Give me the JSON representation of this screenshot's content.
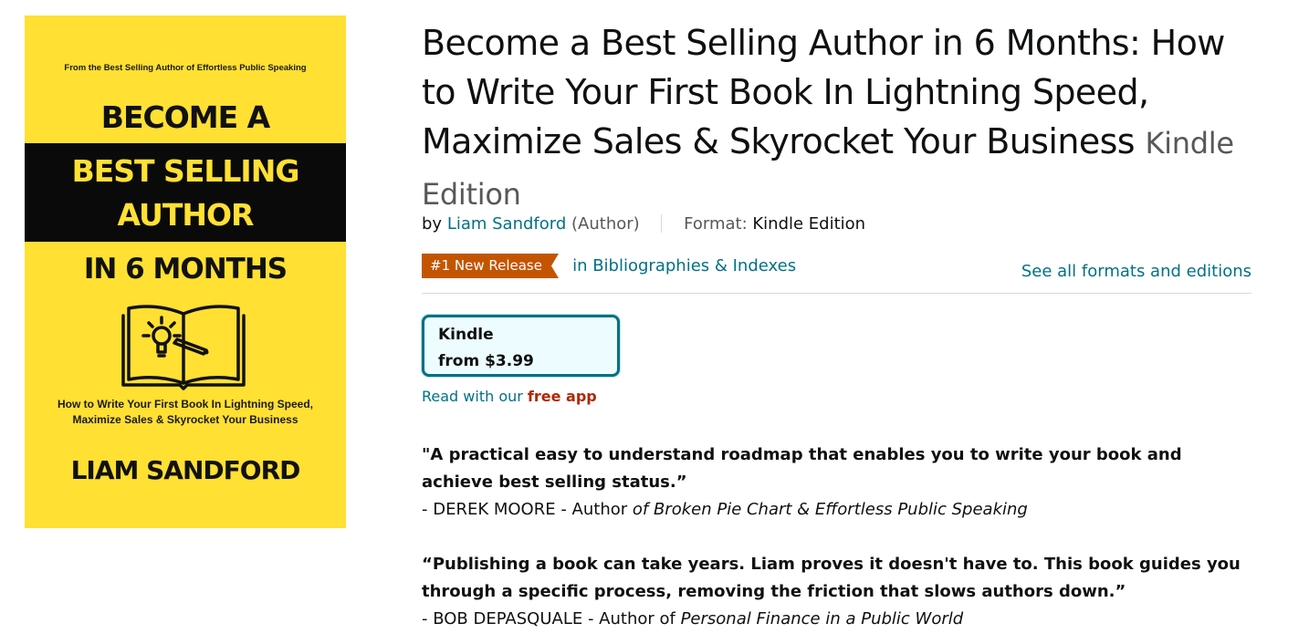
{
  "cover": {
    "top_line": "From the Best Selling Author of Effortless Public Speaking",
    "line1": "BECOME A",
    "line2": "BEST SELLING",
    "line3": "AUTHOR",
    "line4": "IN 6 MONTHS",
    "subtitle_1": "How to Write Your First Book In Lightning Speed,",
    "subtitle_2": "Maximize Sales & Skyrocket Your Business",
    "author": "LIAM SANDFORD",
    "colors": {
      "background": "#ffe033",
      "band": "#0a0a0a"
    },
    "icon": "open-book-lightbulb-pencil-icon"
  },
  "product": {
    "title": "Become a Best Selling Author in 6 Months: How to Write Your First Book In Lightning Speed, Maximize Sales & Skyrocket Your Business",
    "edition": "Kindle Edition"
  },
  "byline": {
    "by": "by",
    "author_name": "Liam Sandford",
    "author_role": "(Author)",
    "format_label": "Format:",
    "format_value": "Kindle Edition"
  },
  "badge": {
    "label": "#1 New Release",
    "category": "in Bibliographies & Indexes",
    "color": "#c45500"
  },
  "see_all": "See all formats and editions",
  "kindle_option": {
    "label": "Kindle",
    "price": "from $3.99"
  },
  "read_app": {
    "prefix": "Read with our",
    "link": "free app"
  },
  "reviews": [
    {
      "quote": "\"A practical easy to understand roadmap that enables you to write your book and achieve best selling status.”",
      "attr_prefix": "- DEREK MOORE - Author ",
      "attr_work": "of Broken Pie Chart & Effortless Public Speaking"
    },
    {
      "quote": "“Publishing a book can take years. Liam proves it doesn't have to. This book guides you through a specific process, removing the friction that slows authors down.”",
      "attr_prefix": "- BOB DEPASQUALE - Author of ",
      "attr_work": "Personal Finance in a Public World"
    }
  ],
  "accent_colors": {
    "link": "#007185",
    "price_red": "#b12704",
    "text": "#0f1111",
    "muted": "#565959"
  }
}
